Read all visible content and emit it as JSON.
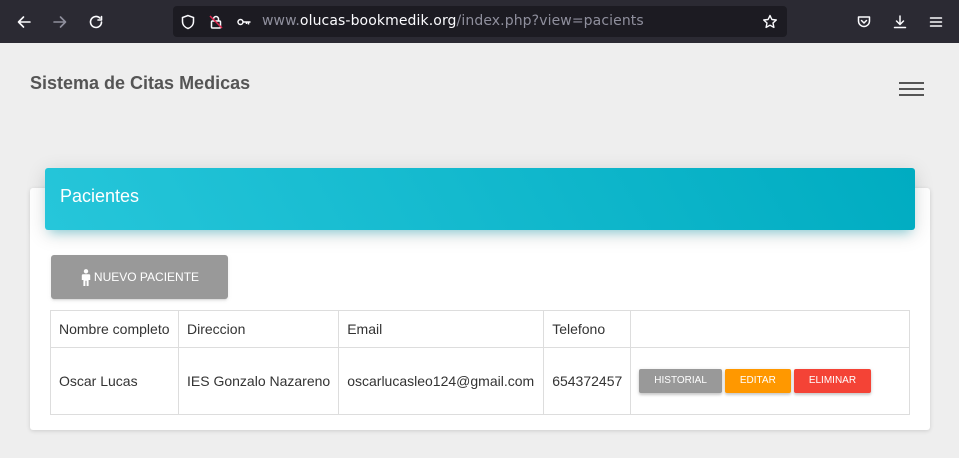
{
  "browser": {
    "url_prefix": "www.",
    "url_host": "olucas-bookmedik.org",
    "url_path": "/index.php?view=pacients"
  },
  "app": {
    "brand": "Sistema de Citas Medicas"
  },
  "card": {
    "title": "Pacientes",
    "new_button_label": "NUEVO PACIENTE"
  },
  "table": {
    "headers": [
      "Nombre completo",
      "Direccion",
      "Email",
      "Telefono",
      ""
    ],
    "rows": [
      {
        "name": "Oscar Lucas",
        "address": "IES Gonzalo Nazareno",
        "email": "oscarlucasleo124@gmail.com",
        "phone": "654372457",
        "actions": [
          "HISTORIAL",
          "EDITAR",
          "ELIMINAR"
        ]
      }
    ]
  },
  "colors": {
    "header_gradient_start": "#26c6da",
    "header_gradient_end": "#00acc1",
    "button_grey": "#999999",
    "button_orange": "#ff9800",
    "button_red": "#f44336",
    "browser_toolbar": "#2b2a33"
  },
  "icons": {
    "back": "arrow-left-icon",
    "forward": "arrow-right-icon",
    "reload": "reload-icon",
    "shield": "shield-icon",
    "insecure": "lock-slash-icon",
    "key": "key-icon",
    "bookmark": "star-icon",
    "pocket": "pocket-icon",
    "downloads": "download-icon",
    "menu": "hamburger-menu-icon",
    "person": "person-icon"
  }
}
